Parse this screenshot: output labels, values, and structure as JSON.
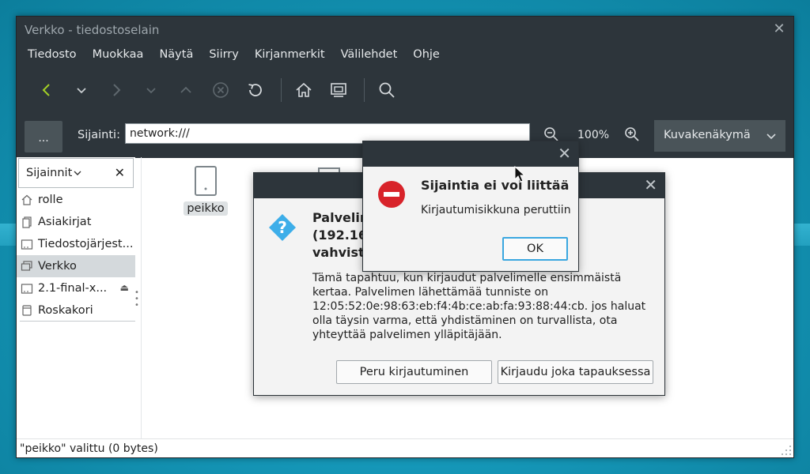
{
  "window": {
    "title": "Verkko - tiedostoselain"
  },
  "menu": [
    "Tiedosto",
    "Muokkaa",
    "Näytä",
    "Siirry",
    "Kirjanmerkit",
    "Välilehdet",
    "Ohje"
  ],
  "toolbar": {
    "icons": [
      "back-icon",
      "history-dropdown-icon",
      "forward-icon",
      "forward-dropdown-icon",
      "up-icon",
      "stop-icon",
      "reload-icon",
      "home-icon",
      "computer-icon",
      "search-icon"
    ]
  },
  "location": {
    "dots_label": "...",
    "label": "Sijainti:",
    "value": "network:///",
    "zoom": "100%",
    "view_mode": "Kuvakenäkymä"
  },
  "sidebar": {
    "header": "Sijainnit",
    "items": [
      {
        "label": "rolle",
        "icon": "home-icon"
      },
      {
        "label": "Asiakirjat",
        "icon": "documents-icon"
      },
      {
        "label": "Tiedostojärjest...",
        "icon": "drive-icon"
      },
      {
        "label": "Verkko",
        "icon": "network-icon"
      },
      {
        "label": "2.1-final-x...",
        "icon": "drive-icon"
      },
      {
        "label": "Roskakori",
        "icon": "trash-icon"
      }
    ]
  },
  "files": [
    {
      "label": "peikko"
    }
  ],
  "status": "\"peikko\" valittu (0 bytes)",
  "auth_dialog": {
    "heading_line1": "Palvelin",
    "heading_line2": "(192.16",
    "heading_line3": "vahvist",
    "body": "Tämä tapahtuu, kun kirjaudut palvelimelle ensimmäistä kertaa. Palvelimen lähettämää tunniste on 12:05:52:0e:98:63:eb:f4:4b:ce:ab:fa:93:88:44:cb. jos haluat olla täysin varma, että yhdistäminen on turvallista, ota yhteyttää palvelimen ylläpitäjään.",
    "cancel_label": "Peru kirjautuminen",
    "login_label": "Kirjaudu joka tapauksessa"
  },
  "error_dialog": {
    "title": "Sijaintia ei voi liittää",
    "message": "Kirjautumisikkuna peruttiin",
    "ok_label": "OK"
  },
  "colors": {
    "titlebar": "#2d353b",
    "accent": "#3aa7e0",
    "error": "#d8232a",
    "question": "#3daee9",
    "back_arrow": "#a3d026"
  }
}
